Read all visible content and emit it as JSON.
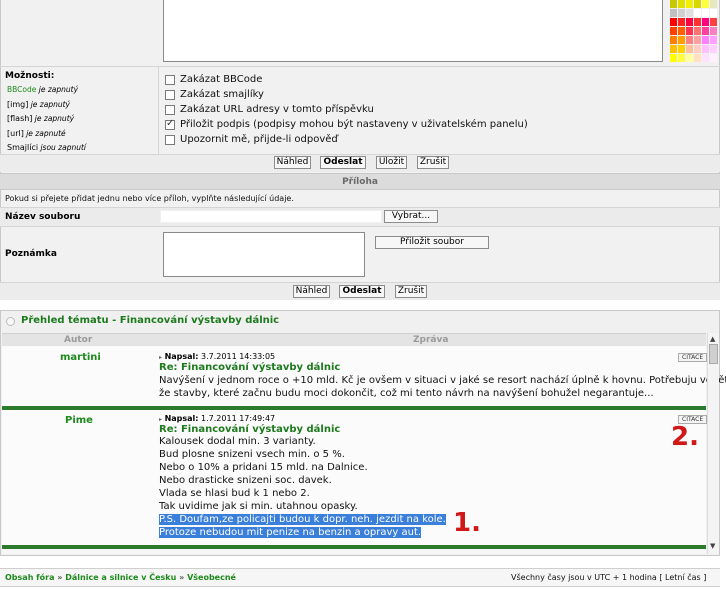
{
  "options": {
    "heading": "Možnosti:",
    "status_lines": [
      {
        "key": "BBCode",
        "rest": " je zapnutý"
      },
      {
        "key": "[img]",
        "rest": " je zapnutý"
      },
      {
        "key": "[flash]",
        "rest": " je zapnutý"
      },
      {
        "key": "[url]",
        "rest": " je zapnuté"
      },
      {
        "key": "Smajlíci",
        "rest": " jsou zapnutí"
      }
    ],
    "checkboxes": [
      {
        "label": "Zakázat BBCode",
        "checked": false
      },
      {
        "label": "Zakázat smajlíky",
        "checked": false
      },
      {
        "label": "Zakázat URL adresy v tomto příspěvku",
        "checked": false
      },
      {
        "label": "Přiložit podpis (podpisy mohou být nastaveny v uživatelském panelu)",
        "checked": true
      },
      {
        "label": "Upozornit mě, přijde-li odpověď",
        "checked": false
      }
    ]
  },
  "buttons": {
    "preview": "Náhled",
    "submit": "Odeslat",
    "save": "Uložit",
    "cancel": "Zrušit"
  },
  "attachment": {
    "header": "Příloha",
    "info": "Pokud si přejete přidat jednu nebo více příloh, vyplňte následující údaje.",
    "filename_label": "Název souboru",
    "browse": "Vybrat...",
    "note_label": "Poznámka",
    "attach_button": "Přiložit soubor"
  },
  "topic_review": {
    "title": "Přehled tématu - Financování výstavby dálnic",
    "col_author": "Autor",
    "col_message": "Zpráva",
    "posts": [
      {
        "author": "martini",
        "posted_label": "Napsal:",
        "date": " 3.7.2011 14:33:05",
        "subject": "Re: Financování výstavby dálnic",
        "quote": "CITACE",
        "lines": [
          "Navýšení v jednom roce o +10 mld. Kč je ovšem v situaci v jaké se resort nachází úplně k hovnu. Potřebuju vědět,",
          "že stavby, které začnu budu moci dokončit, což mi tento návrh na navýšení bohužel negarantuje..."
        ],
        "highlighted": []
      },
      {
        "author": "Pime",
        "posted_label": "Napsal:",
        "date": " 1.7.2011 17:49:47",
        "subject": "Re: Financování výstavby dálnic",
        "quote": "CITACE",
        "lines": [
          "Kalousek dodal min. 3 varianty.",
          "Bud plosne snizeni vsech min. o 5 %.",
          "Nebo o 10% a pridani 15 mld. na Dalnice.",
          "Nebo drasticke snizeni soc. davek.",
          "Vlada se hlasi bud k 1 nebo 2.",
          "Tak uvidime jak si min. utahnou opasky."
        ],
        "highlighted": [
          "P.S. Doufam,ze policajti budou k dopr. neh. jezdit na kole.",
          "Protoze nebudou mit penize na benzin a opravy aut."
        ]
      }
    ]
  },
  "annotations": {
    "one": "1.",
    "two": "2."
  },
  "footer": {
    "crumbs": [
      "Obsah fóra",
      "Dálnice a silnice v Česku",
      "Všeobecné"
    ],
    "sep": " » ",
    "timezone": "Všechny časy jsou v UTC + 1 hodina [ Letní čas ]"
  },
  "colors": {
    "accent_green": "#1d8a1d",
    "annotation_red": "#d01818",
    "highlight_blue": "#3a7fd9"
  }
}
